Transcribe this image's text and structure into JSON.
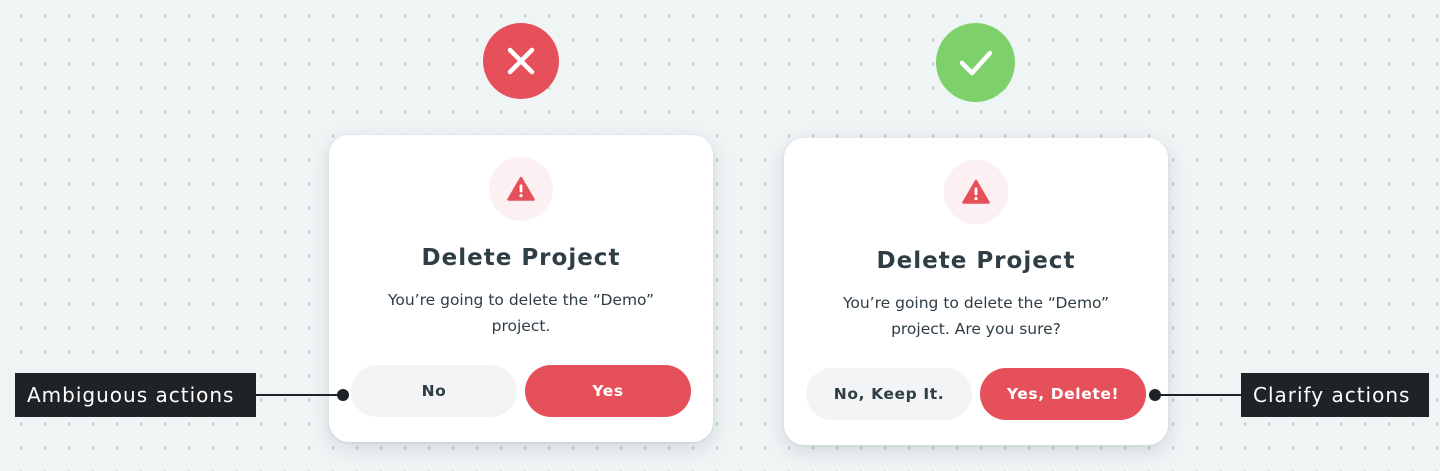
{
  "bad_example": {
    "verdict_icon": "close-x-icon",
    "verdict_color": "#e5505b",
    "dialog": {
      "icon": "warning-triangle-icon",
      "title": "Delete Project",
      "message": "You’re going to delete the “Demo” project.",
      "secondary_button": "No",
      "primary_button": "Yes"
    },
    "annotation": "Ambiguous actions"
  },
  "good_example": {
    "verdict_icon": "check-icon",
    "verdict_color": "#7ed06a",
    "dialog": {
      "icon": "warning-triangle-icon",
      "title": "Delete Project",
      "message": "You’re going to delete the “Demo” project. Are you sure?",
      "secondary_button": "No, Keep It.",
      "primary_button": "Yes, Delete!"
    },
    "annotation": "Clarify actions"
  },
  "colors": {
    "danger": "#e5505b",
    "success": "#7ed06a",
    "text": "#2f3d45",
    "annotation_bg": "#1f2326",
    "background": "#eff4f5"
  }
}
